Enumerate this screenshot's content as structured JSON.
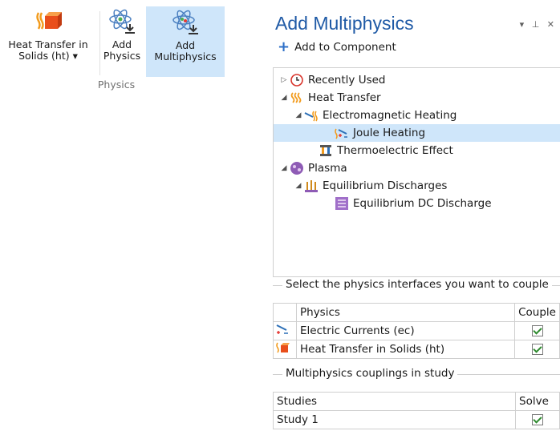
{
  "ribbon": {
    "buttons": [
      {
        "line1": "Heat Transfer in",
        "line2": "Solids (ht) ▾",
        "icon": "heat-transfer-solids-icon"
      },
      {
        "line1": "Add",
        "line2": "Physics",
        "icon": "add-physics-icon"
      },
      {
        "line1": "Add",
        "line2": "Multiphysics",
        "icon": "add-multiphysics-icon"
      }
    ],
    "group_label": "Physics"
  },
  "panel": {
    "title": "Add Multiphysics",
    "controls": "▾ ⊥ ✕",
    "add_to_component": "Add to Component",
    "tree": [
      {
        "label": "Recently Used",
        "icon": "clock-icon",
        "toggle": "▷"
      },
      {
        "label": "Heat Transfer",
        "icon": "heat-icon",
        "toggle": "◢"
      },
      {
        "label": "Electromagnetic Heating",
        "icon": "em-heating-icon",
        "toggle": "◢"
      },
      {
        "label": "Joule Heating",
        "icon": "joule-heating-icon",
        "toggle": ""
      },
      {
        "label": "Thermoelectric Effect",
        "icon": "thermoelectric-icon",
        "toggle": ""
      },
      {
        "label": "Plasma",
        "icon": "plasma-icon",
        "toggle": "◢"
      },
      {
        "label": "Equilibrium Discharges",
        "icon": "discharge-icon",
        "toggle": "◢"
      },
      {
        "label": "Equilibrium DC Discharge",
        "icon": "dc-discharge-icon",
        "toggle": ""
      }
    ],
    "couple_section": "Select the physics interfaces you want to couple",
    "physics_table": {
      "headers": [
        "Physics",
        "Couple"
      ],
      "rows": [
        {
          "name": "Electric Currents (ec)",
          "icon": "electric-currents-icon",
          "checked": true
        },
        {
          "name": "Heat Transfer in Solids (ht)",
          "icon": "heat-transfer-solids-icon",
          "checked": true
        }
      ]
    },
    "study_section": "Multiphysics couplings in study",
    "study_table": {
      "headers": [
        "Studies",
        "Solve"
      ],
      "rows": [
        {
          "name": "Study 1",
          "checked": true
        }
      ]
    }
  }
}
